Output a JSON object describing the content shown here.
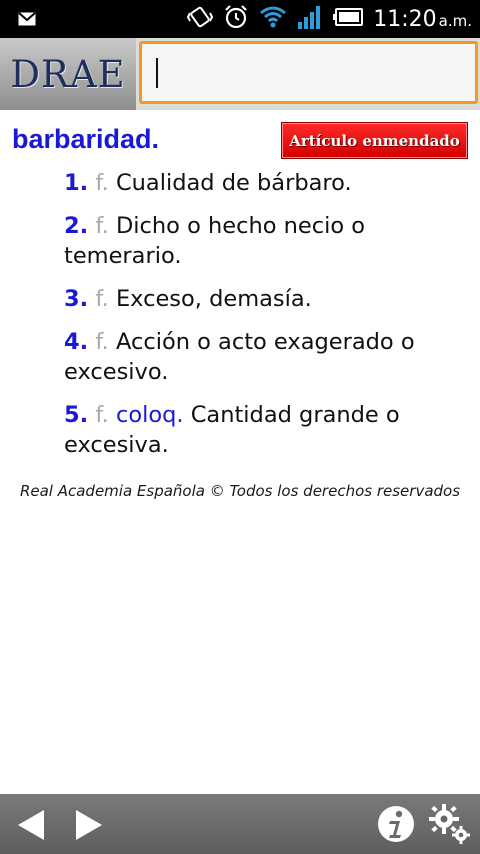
{
  "status_bar": {
    "time": "11:20",
    "ampm": "a.m.",
    "icons": [
      "mail-icon",
      "vibrate-icon",
      "alarm-icon",
      "wifi-icon",
      "signal-icon",
      "battery-icon"
    ]
  },
  "header": {
    "logo_text": "DRAE",
    "search": {
      "value": "",
      "placeholder": ""
    }
  },
  "entry": {
    "headword": "barbaridad.",
    "badge": "Artículo enmendado",
    "definitions": [
      {
        "num": "1.",
        "gram": "f.",
        "usage": "",
        "text": "Cualidad de bárbaro."
      },
      {
        "num": "2.",
        "gram": "f.",
        "usage": "",
        "text": "Dicho o hecho necio o temerario."
      },
      {
        "num": "3.",
        "gram": "f.",
        "usage": "",
        "text": "Exceso, demasía."
      },
      {
        "num": "4.",
        "gram": "f.",
        "usage": "",
        "text": "Acción o acto exagerado o excesivo."
      },
      {
        "num": "5.",
        "gram": "f.",
        "usage": "coloq.",
        "text": "Cantidad grande o excesiva."
      }
    ]
  },
  "footer_note": "Real Academia Española © Todos los derechos reservados",
  "bottom_bar": {
    "icons": [
      "back-arrow-icon",
      "forward-arrow-icon",
      "info-icon",
      "gear-icon"
    ]
  },
  "colors": {
    "headword": "#1a1ad6",
    "badge": "#e00000",
    "search_border": "#f39a1e",
    "bottom_bar": "#6e6e6e"
  }
}
